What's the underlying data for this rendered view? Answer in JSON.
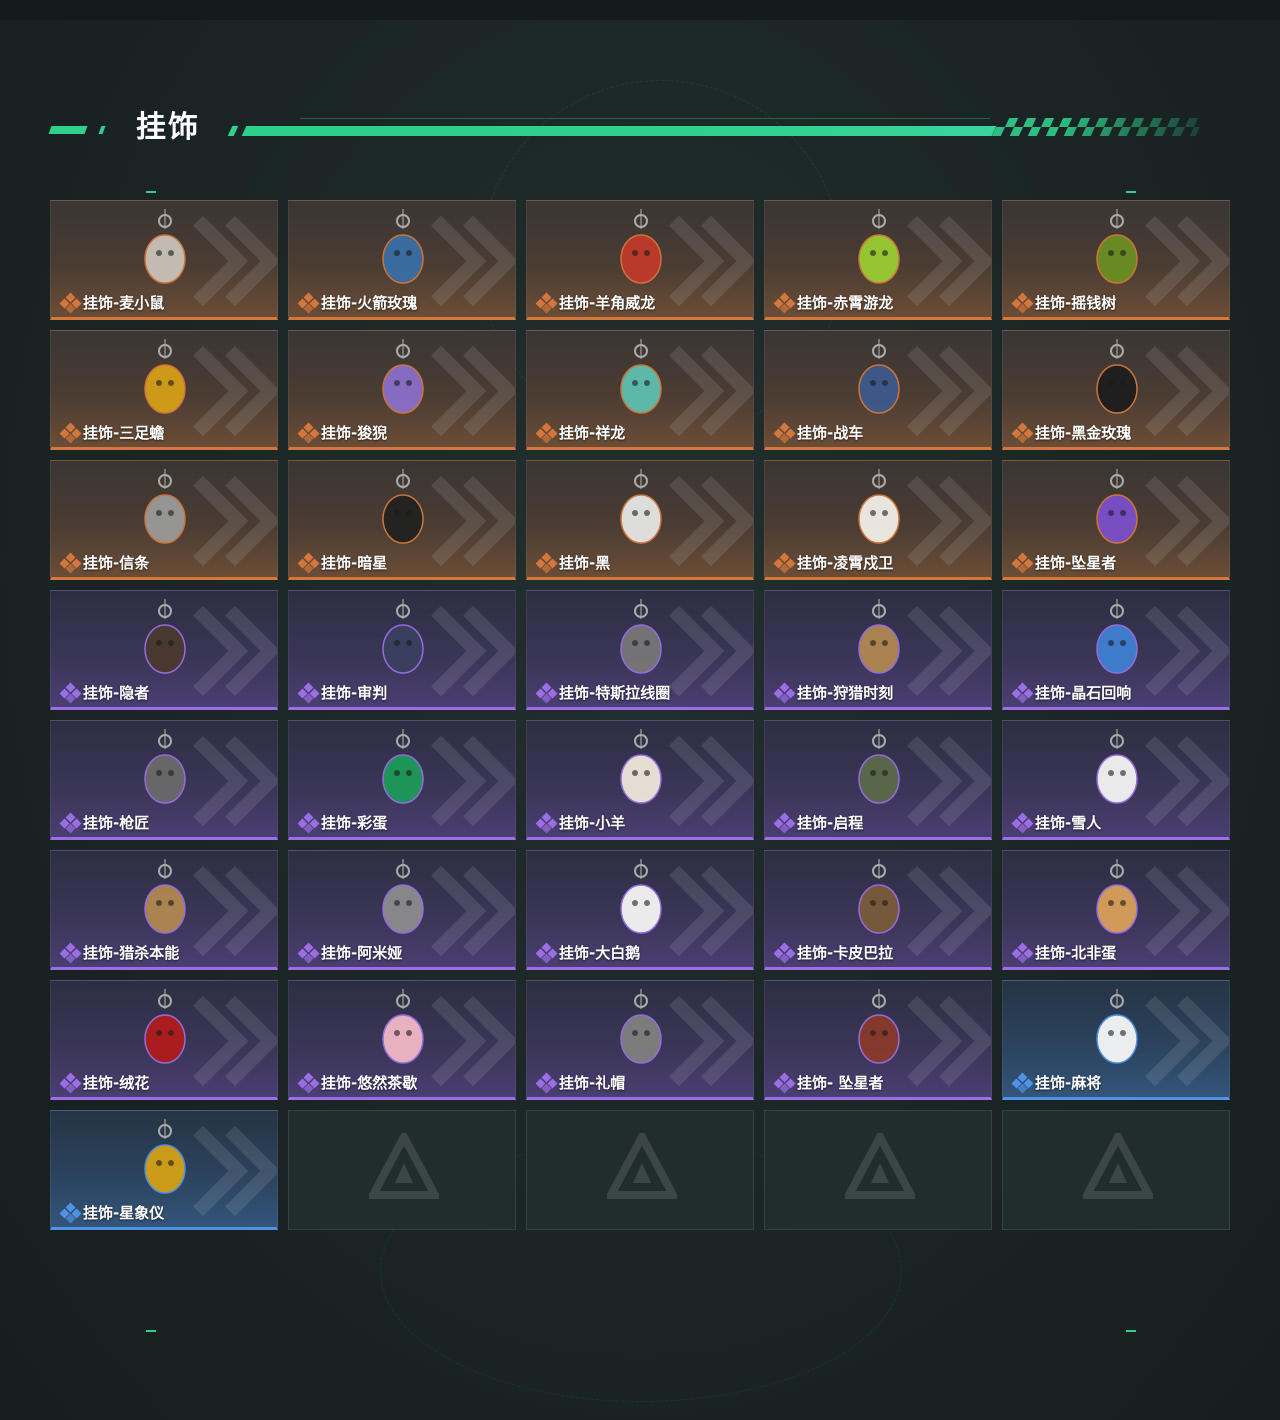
{
  "section": {
    "title": "挂饰"
  },
  "colors": {
    "accent": "#2fd08c",
    "orange": "#d4773c",
    "purple": "#9b6ee6",
    "blue": "#4f93e6"
  },
  "items": [
    {
      "label": "挂饰-麦小鼠",
      "rarity": "orange",
      "icon": "mouse-charm-icon"
    },
    {
      "label": "挂饰-火箭玫瑰",
      "rarity": "orange",
      "icon": "rocket-rose-charm-icon"
    },
    {
      "label": "挂饰-羊角威龙",
      "rarity": "orange",
      "icon": "horned-dragon-charm-icon"
    },
    {
      "label": "挂饰-赤霄游龙",
      "rarity": "orange",
      "icon": "chixiao-dragon-charm-icon"
    },
    {
      "label": "挂饰-摇钱树",
      "rarity": "orange",
      "icon": "money-tree-charm-icon"
    },
    {
      "label": "挂饰-三足蟾",
      "rarity": "orange",
      "icon": "three-legged-toad-charm-icon"
    },
    {
      "label": "挂饰-狻猊",
      "rarity": "orange",
      "icon": "suanni-charm-icon"
    },
    {
      "label": "挂饰-祥龙",
      "rarity": "orange",
      "icon": "auspicious-dragon-charm-icon"
    },
    {
      "label": "挂饰-战车",
      "rarity": "orange",
      "icon": "chariot-card-charm-icon"
    },
    {
      "label": "挂饰-黑金玫瑰",
      "rarity": "orange",
      "icon": "black-gold-rose-charm-icon"
    },
    {
      "label": "挂饰-信条",
      "rarity": "orange",
      "icon": "creed-charm-icon"
    },
    {
      "label": "挂饰-暗星",
      "rarity": "orange",
      "icon": "dark-star-charm-icon"
    },
    {
      "label": "挂饰-黑",
      "rarity": "orange",
      "icon": "black-tag-charm-icon"
    },
    {
      "label": "挂饰-凌霄戍卫",
      "rarity": "orange",
      "icon": "guardian-charm-icon"
    },
    {
      "label": "挂饰-坠星者",
      "rarity": "orange",
      "icon": "crystal-pendant-charm-icon"
    },
    {
      "label": "挂饰-隐者",
      "rarity": "purple",
      "icon": "hermit-card-charm-icon"
    },
    {
      "label": "挂饰-审判",
      "rarity": "purple",
      "icon": "judgement-card-charm-icon"
    },
    {
      "label": "挂饰-特斯拉线圈",
      "rarity": "purple",
      "icon": "tesla-coil-charm-icon"
    },
    {
      "label": "挂饰-狩猎时刻",
      "rarity": "purple",
      "icon": "moose-antler-charm-icon"
    },
    {
      "label": "挂饰-晶石回响",
      "rarity": "purple",
      "icon": "crystal-echo-charm-icon"
    },
    {
      "label": "挂饰-枪匠",
      "rarity": "purple",
      "icon": "gunsmith-charm-icon"
    },
    {
      "label": "挂饰-彩蛋",
      "rarity": "purple",
      "icon": "easter-egg-charm-icon"
    },
    {
      "label": "挂饰-小羊",
      "rarity": "purple",
      "icon": "lamb-charm-icon"
    },
    {
      "label": "挂饰-启程",
      "rarity": "purple",
      "icon": "departure-charm-icon"
    },
    {
      "label": "挂饰-雪人",
      "rarity": "purple",
      "icon": "snowman-charm-icon"
    },
    {
      "label": "挂饰-猎杀本能",
      "rarity": "purple",
      "icon": "moose-antler-charm-icon"
    },
    {
      "label": "挂饰-阿米娅",
      "rarity": "purple",
      "icon": "amiya-charm-icon"
    },
    {
      "label": "挂饰-大白鹅",
      "rarity": "purple",
      "icon": "goose-charm-icon"
    },
    {
      "label": "挂饰-卡皮巴拉",
      "rarity": "purple",
      "icon": "capybara-charm-icon"
    },
    {
      "label": "挂饰-北非蛋",
      "rarity": "purple",
      "icon": "shakshuka-charm-icon"
    },
    {
      "label": "挂饰-绒花",
      "rarity": "purple",
      "icon": "velvet-flower-charm-icon"
    },
    {
      "label": "挂饰-悠然茶歇",
      "rarity": "purple",
      "icon": "cupcake-charm-icon"
    },
    {
      "label": "挂饰-礼帽",
      "rarity": "purple",
      "icon": "fedora-charm-icon"
    },
    {
      "label": "挂饰- 坠星者",
      "rarity": "purple",
      "icon": "triangle-badge-charm-icon"
    },
    {
      "label": "挂饰-麻将",
      "rarity": "blue",
      "icon": "mahjong-charm-icon"
    },
    {
      "label": "挂饰-星象仪",
      "rarity": "blue",
      "icon": "astrolabe-charm-icon"
    },
    {
      "label": "",
      "rarity": "empty",
      "icon": "empty-slot-logo-icon"
    },
    {
      "label": "",
      "rarity": "empty",
      "icon": "empty-slot-logo-icon"
    },
    {
      "label": "",
      "rarity": "empty",
      "icon": "empty-slot-logo-icon"
    },
    {
      "label": "",
      "rarity": "empty",
      "icon": "empty-slot-logo-icon"
    }
  ]
}
